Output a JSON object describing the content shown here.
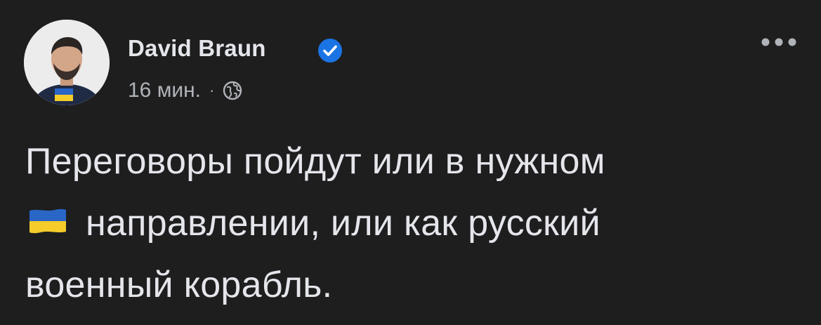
{
  "author": {
    "name": "David Braun",
    "verified_icon": "verified-badge-icon",
    "avatar_icon": "profile-photo"
  },
  "meta": {
    "time": "16 мин.",
    "separator": "·",
    "audience_icon": "globe-icon"
  },
  "more_menu_icon": "more-options-icon",
  "post": {
    "line1": "Переговоры пойдут или в нужном",
    "line2_flag": "ukraine-flag-emoji",
    "line2": "направлении,  или как русский",
    "line3": "военный корабль."
  },
  "colors": {
    "background": "#1e1e1f",
    "text_primary": "#e4e6eb",
    "text_secondary": "#b0b3b8",
    "verified_blue": "#1b74e4",
    "flag_blue": "#2a66c6",
    "flag_yellow": "#f6cc2a"
  }
}
